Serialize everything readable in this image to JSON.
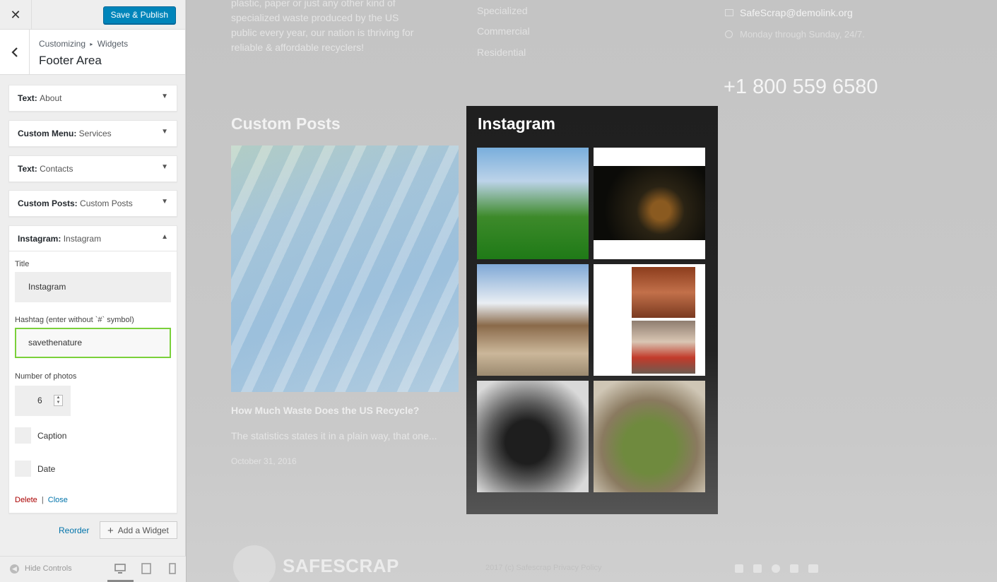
{
  "customizer": {
    "close_label": "✕",
    "publish_label": "Save & Publish",
    "breadcrumb": {
      "root": "Customizing",
      "separator": "▸",
      "current": "Widgets"
    },
    "section_title": "Footer Area",
    "widgets": [
      {
        "type": "Text:",
        "name": "About"
      },
      {
        "type": "Custom Menu:",
        "name": "Services"
      },
      {
        "type": "Text:",
        "name": "Contacts"
      },
      {
        "type": "Custom Posts:",
        "name": "Custom Posts"
      },
      {
        "type": "Instagram:",
        "name": "Instagram"
      }
    ],
    "instagram_form": {
      "title_label": "Title",
      "title_value": "Instagram",
      "hashtag_label": "Hashtag (enter without `#` symbol)",
      "hashtag_value": "savethenature",
      "photos_label": "Number of photos",
      "photos_value": "6",
      "caption_label": "Caption",
      "date_label": "Date",
      "delete_label": "Delete",
      "separator": "|",
      "close_label": "Close"
    },
    "reorder_label": "Reorder",
    "add_widget_label": "Add a Widget",
    "hide_controls_label": "Hide Controls"
  },
  "preview": {
    "about_text": "plastic, paper or just any other kind of specialized waste produced by the US public every year, our nation is thriving for reliable & affordable recyclers!",
    "services": [
      "Specialized",
      "Commercial",
      "Residential"
    ],
    "email": "SafeScrap@demolink.org",
    "hours": "Monday through Sunday, 24/7.",
    "phone": "+1 800 559 6580",
    "custom_posts_heading": "Custom Posts",
    "post_title": "How Much Waste Does the US Recycle?",
    "post_excerpt": "The statistics states it in a plain way, that one...",
    "post_date": "October 31, 2016",
    "instagram_heading": "Instagram",
    "brand": "SAFESCRAP",
    "copyright": "2017 (c) Safescrap Privacy Policy"
  },
  "colors": {
    "accent": "#0085ba",
    "focus": "#7ad03a",
    "delete": "#aa0000",
    "link": "#0073aa"
  }
}
